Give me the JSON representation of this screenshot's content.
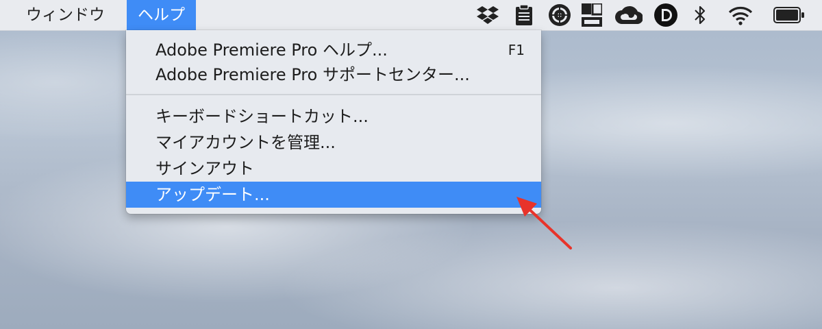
{
  "menubar": {
    "items": [
      {
        "label": "ウィンドウ"
      },
      {
        "label": "ヘルプ",
        "active": true
      }
    ],
    "status_icons": [
      "dropbox-icon",
      "clipboard-icon",
      "gear-dial-icon",
      "window-layout-icon",
      "creative-cloud-icon",
      "d-badge-icon",
      "bluetooth-icon",
      "wifi-icon",
      "battery-icon"
    ]
  },
  "help_menu": {
    "items": [
      {
        "label": "Adobe Premiere Pro ヘルプ...",
        "shortcut": "F1"
      },
      {
        "label": "Adobe Premiere Pro サポートセンター..."
      },
      {
        "label": "キーボードショートカット..."
      },
      {
        "label": "マイアカウントを管理..."
      },
      {
        "label": "サインアウト"
      },
      {
        "label": "アップデート...",
        "highlighted": true
      }
    ]
  },
  "colors": {
    "highlight": "#3f8cf6",
    "annotation_arrow": "#e8332a"
  }
}
